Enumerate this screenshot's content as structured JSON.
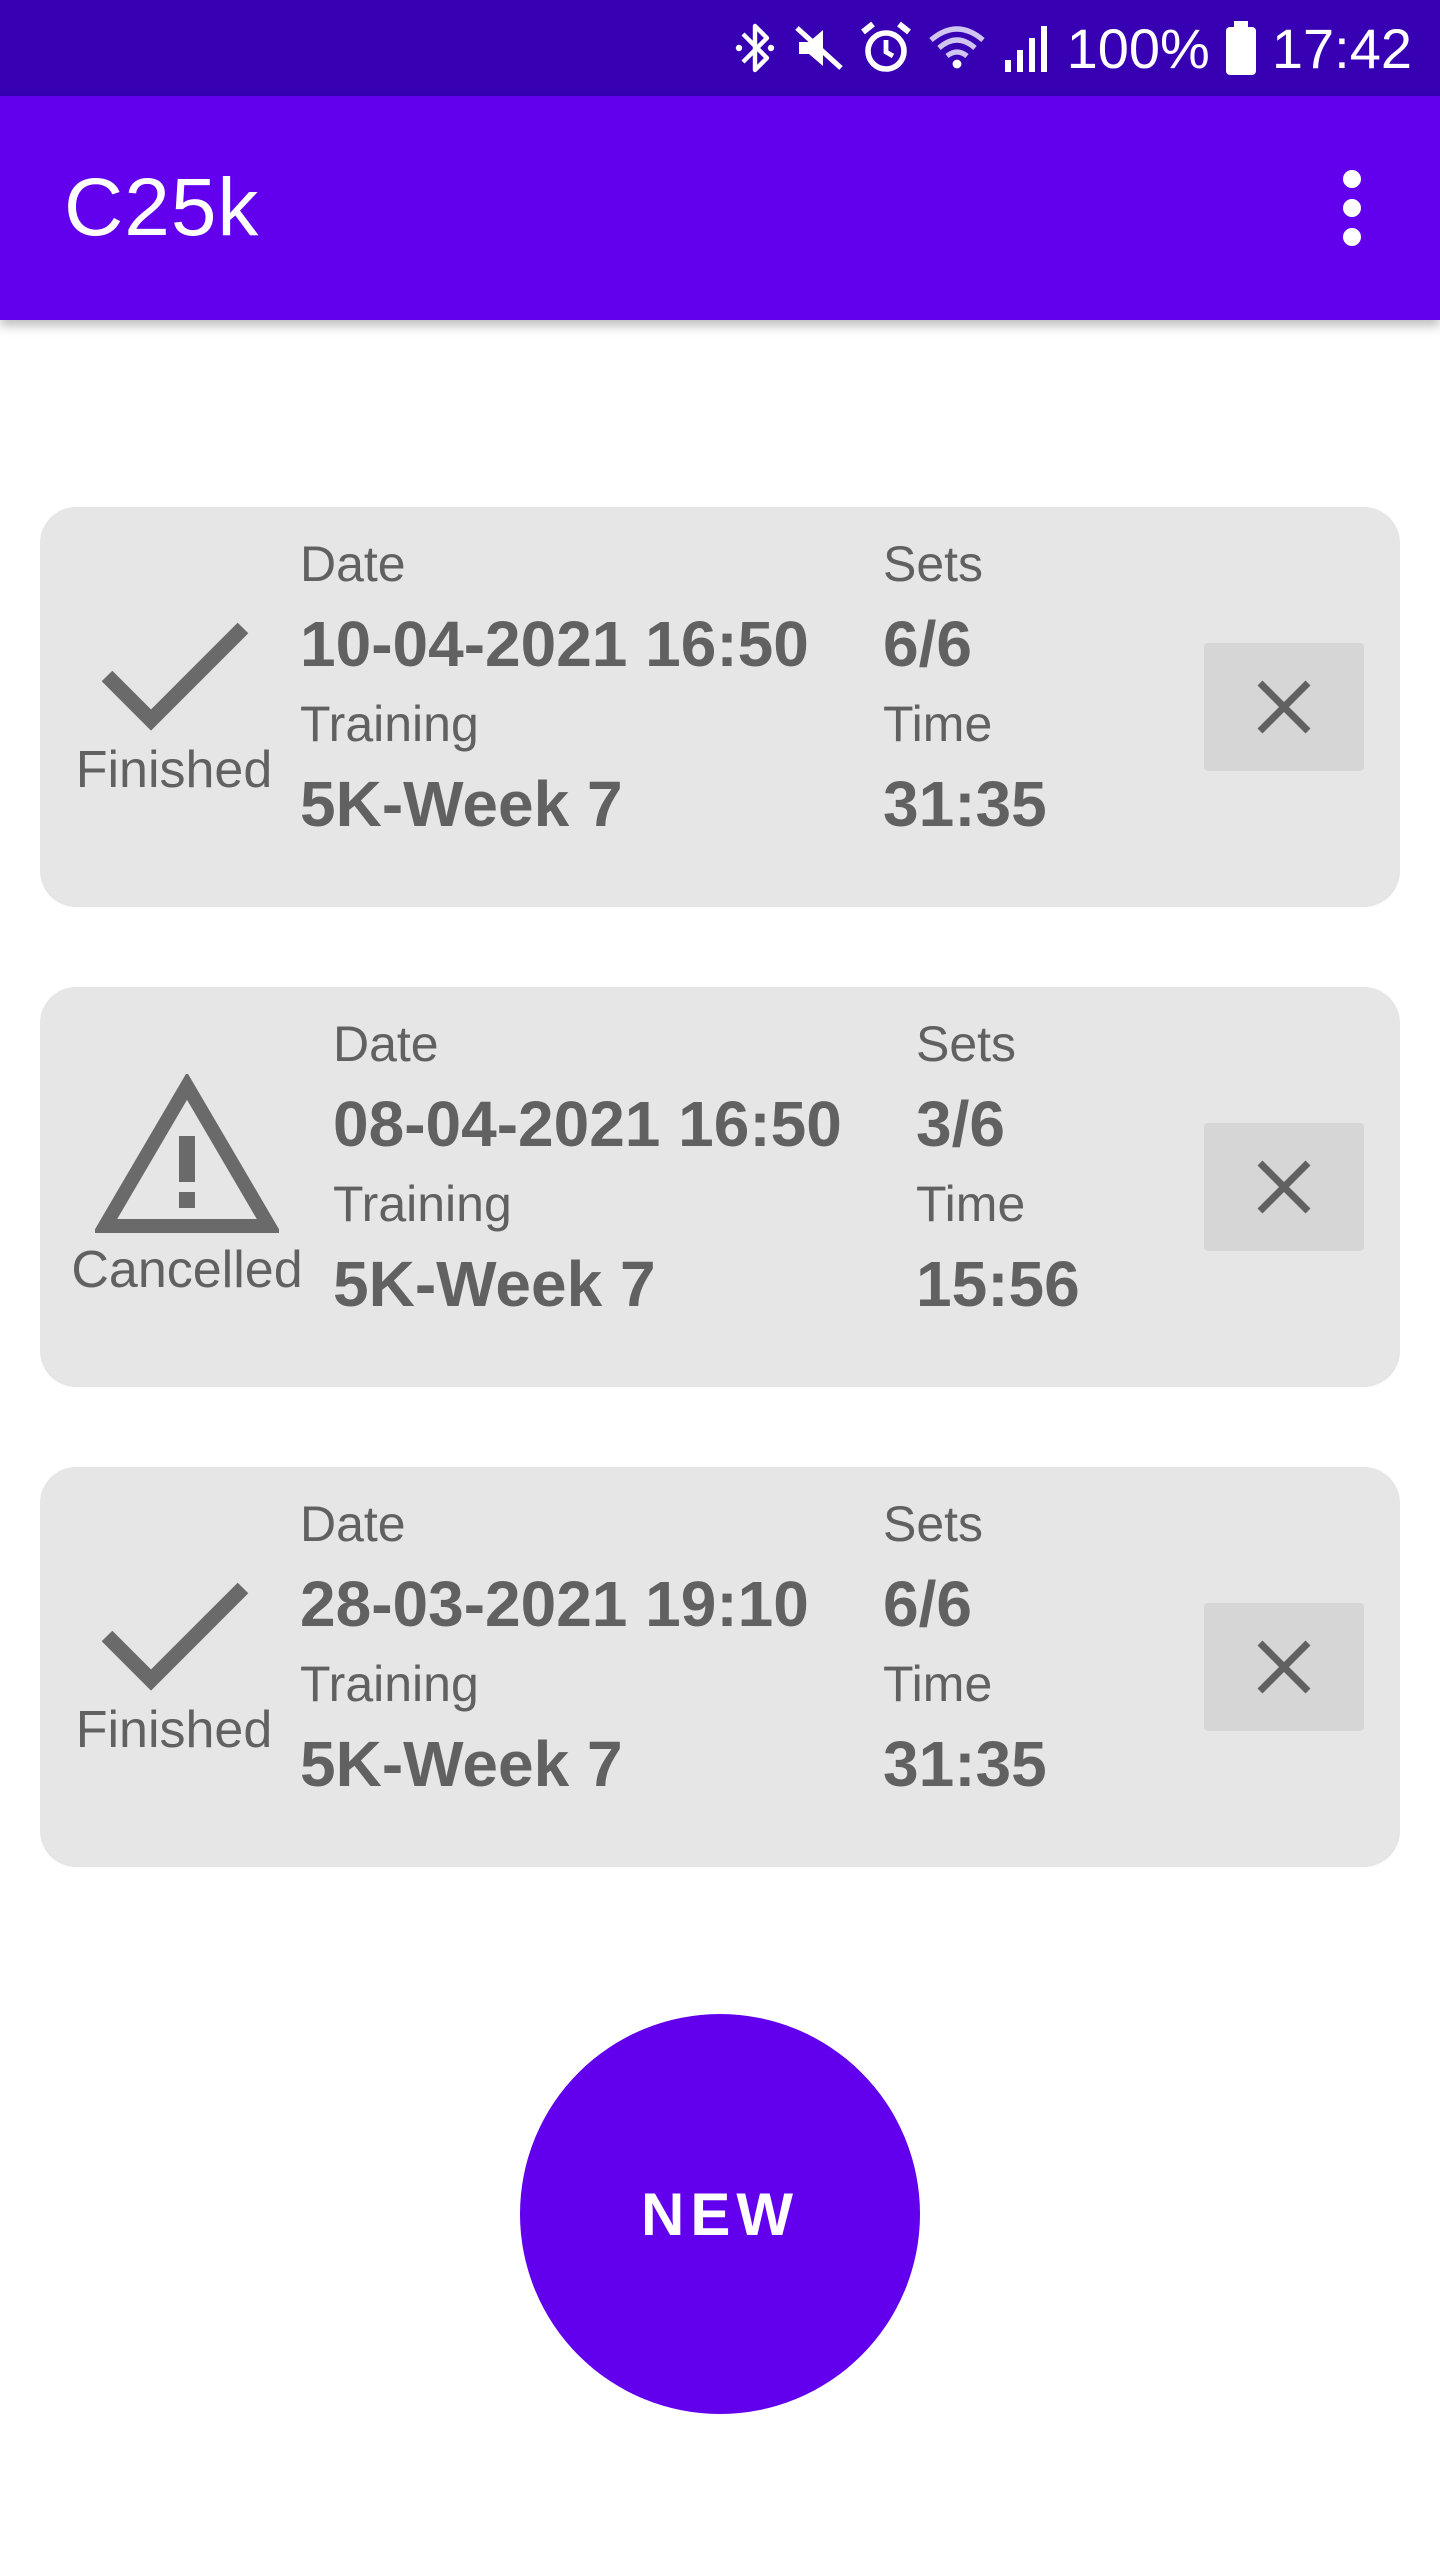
{
  "status_bar": {
    "battery": "100%",
    "time": "17:42",
    "icons": [
      "bluetooth-icon",
      "mute-icon",
      "alarm-icon",
      "wifi-icon",
      "signal-icon",
      "battery-icon"
    ]
  },
  "app_bar": {
    "title": "C25k",
    "menu_icon": "more-vert-icon"
  },
  "labels": {
    "date": "Date",
    "sets": "Sets",
    "training": "Training",
    "time": "Time"
  },
  "sessions": [
    {
      "status": "Finished",
      "status_icon": "check-icon",
      "date": "10-04-2021 16:50",
      "sets": "6/6",
      "training": "5K-Week 7",
      "time": "31:35",
      "delete_icon": "close-icon"
    },
    {
      "status": "Cancelled",
      "status_icon": "warning-icon",
      "date": "08-04-2021 16:50",
      "sets": "3/6",
      "training": "5K-Week 7",
      "time": "15:56",
      "delete_icon": "close-icon"
    },
    {
      "status": "Finished",
      "status_icon": "check-icon",
      "date": "28-03-2021 19:10",
      "sets": "6/6",
      "training": "5K-Week 7",
      "time": "31:35",
      "delete_icon": "close-icon"
    }
  ],
  "new_button": {
    "label": "NEW"
  },
  "colors": {
    "status_bar": "#3700b3",
    "primary": "#6200ee",
    "card": "#e6e6e6",
    "text": "#616161"
  }
}
